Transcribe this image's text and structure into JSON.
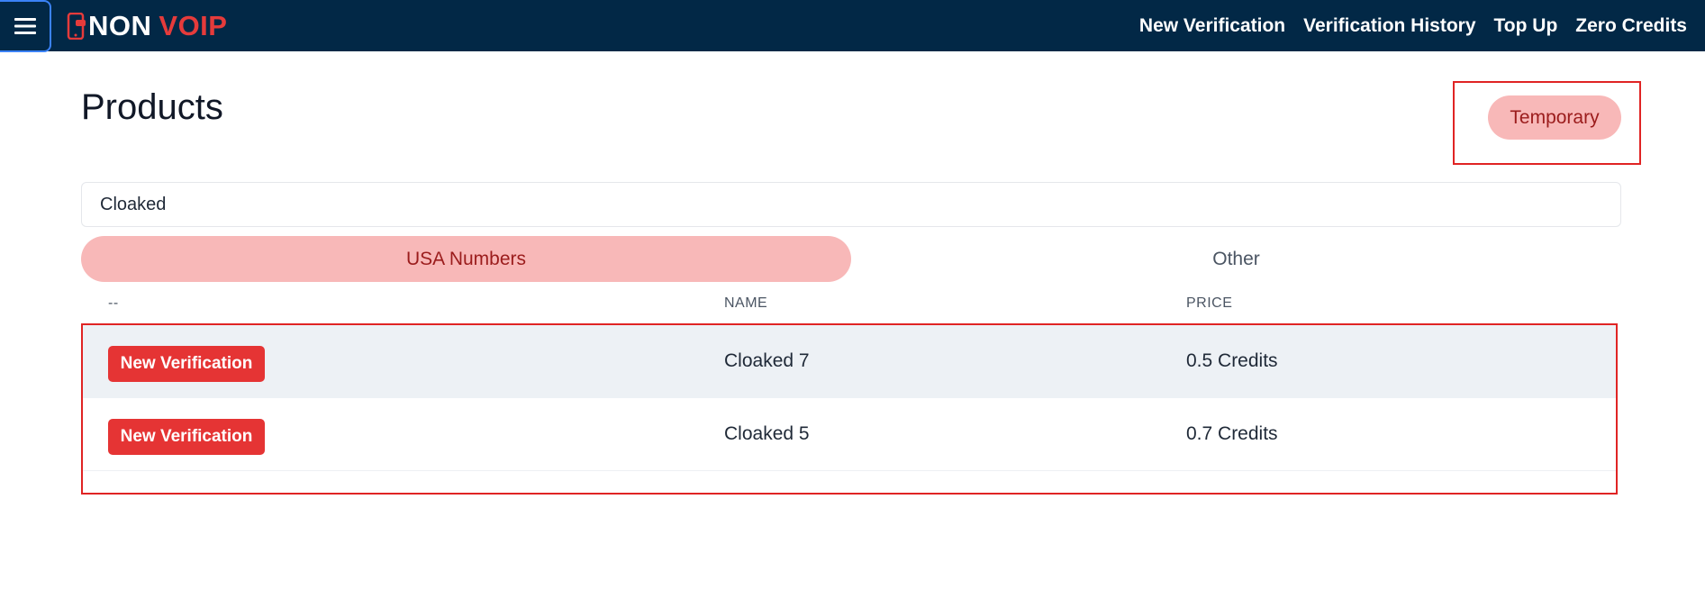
{
  "brand": {
    "logo_text_1": "NON",
    "logo_text_2": "VOIP",
    "colors": {
      "navbar": "#022846",
      "accent": "#e53434",
      "accent_soft": "#f8b8b8",
      "accent_text": "#9b1c1c"
    }
  },
  "nav": {
    "menu_icon": "hamburger-icon",
    "links": [
      "New Verification",
      "Verification History",
      "Top Up",
      "Zero Credits"
    ]
  },
  "page": {
    "title": "Products",
    "type_button": "Temporary"
  },
  "search": {
    "value": "Cloaked"
  },
  "tabs": [
    {
      "label": "USA Numbers",
      "active": true
    },
    {
      "label": "Other",
      "active": false
    }
  ],
  "table": {
    "headers": [
      "--",
      "NAME",
      "PRICE"
    ],
    "rows": [
      {
        "action": "New Verification",
        "name": "Cloaked 7",
        "price": "0.5 Credits"
      },
      {
        "action": "New Verification",
        "name": "Cloaked 5",
        "price": "0.7 Credits"
      }
    ]
  }
}
